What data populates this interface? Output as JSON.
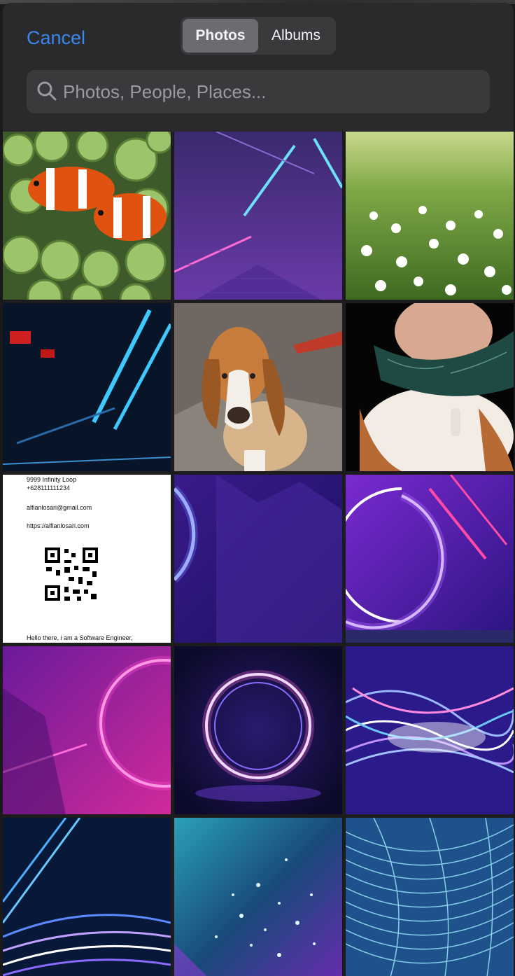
{
  "header": {
    "cancel_label": "Cancel",
    "segments": [
      {
        "label": "Photos",
        "selected": true
      },
      {
        "label": "Albums",
        "selected": false
      }
    ],
    "search": {
      "placeholder": "Photos, People, Places...",
      "value": ""
    }
  },
  "colors": {
    "accent": "#3b87f0",
    "header_bg": "#2a2a2c",
    "field_bg": "#3a3a3c"
  },
  "photos": [
    {
      "subject": "clownfish-anemone"
    },
    {
      "subject": "neon-triangle-tunnel"
    },
    {
      "subject": "white-flowers-meadow"
    },
    {
      "subject": "blue-neon-lines"
    },
    {
      "subject": "basset-hound-dog"
    },
    {
      "subject": "basset-hound-bandana"
    },
    {
      "subject": "business-card-document",
      "lines": {
        "address": "9999 Infinity Loop",
        "phone": "+628111111234",
        "email": "alfianlosari@gmail.com",
        "website": "https://alfianlosari.com",
        "bio": "Hello there, i am a Software Engineer,"
      }
    },
    {
      "subject": "neon-circle-partial"
    },
    {
      "subject": "purple-neon-arc"
    },
    {
      "subject": "pink-neon-ring"
    },
    {
      "subject": "neon-ring-center"
    },
    {
      "subject": "purple-light-streaks"
    },
    {
      "subject": "blue-waves-light"
    },
    {
      "subject": "cyan-particles"
    },
    {
      "subject": "cyan-light-fibers"
    }
  ]
}
